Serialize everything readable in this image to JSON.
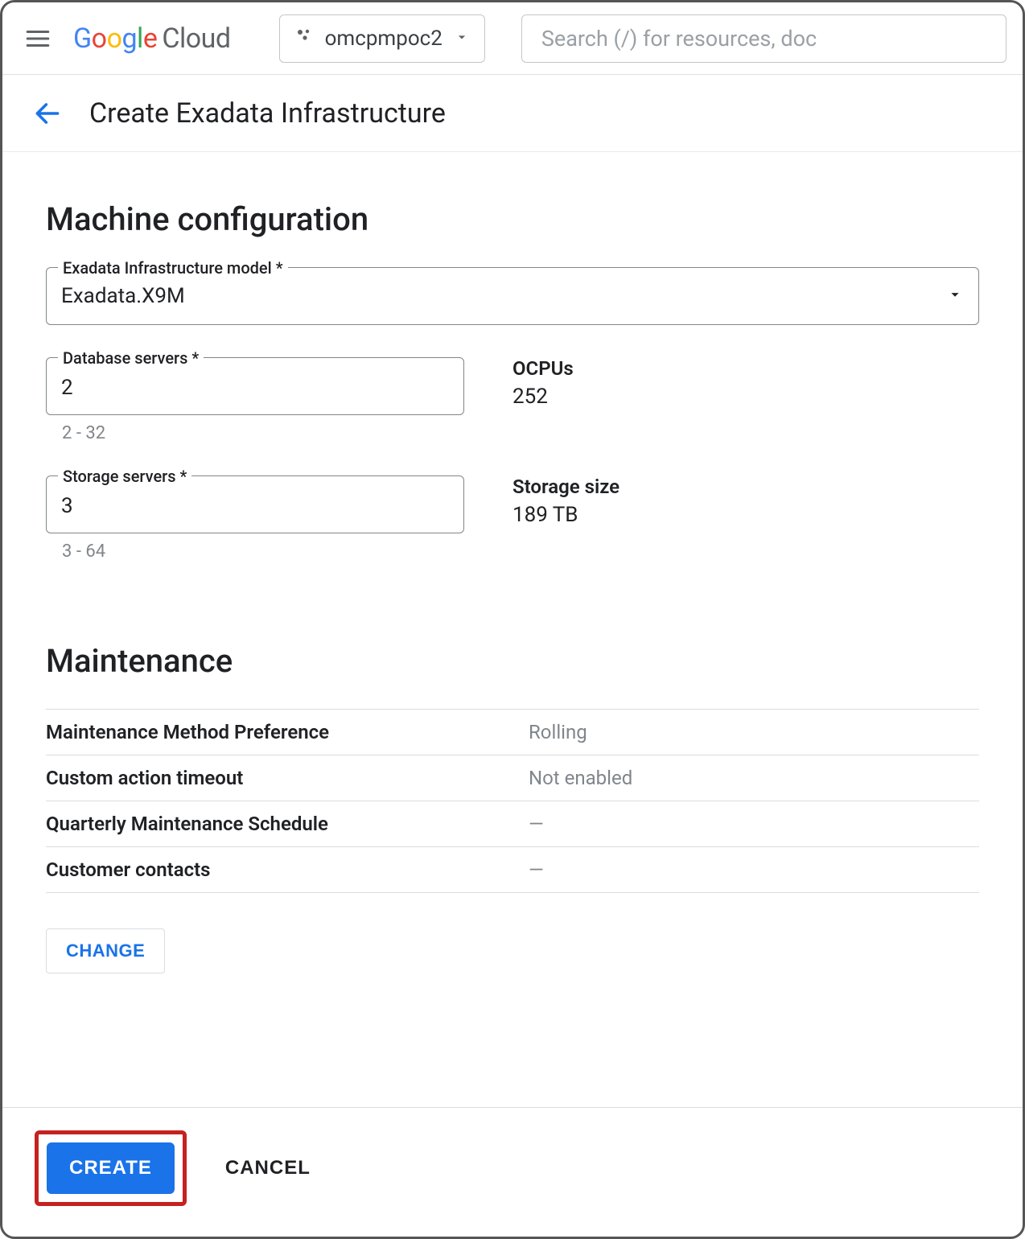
{
  "header": {
    "logo_google": [
      "G",
      "o",
      "o",
      "g",
      "l",
      "e"
    ],
    "logo_cloud": "Cloud",
    "project_name": "omcpmpoc2",
    "search_placeholder": "Search (/) for resources, doc"
  },
  "subheader": {
    "title": "Create Exadata Infrastructure"
  },
  "machine_config": {
    "section_title": "Machine configuration",
    "model_label": "Exadata Infrastructure model *",
    "model_value": "Exadata.X9M",
    "db_servers_label": "Database servers *",
    "db_servers_value": "2",
    "db_servers_helper": "2 - 32",
    "ocpus_label": "OCPUs",
    "ocpus_value": "252",
    "storage_servers_label": "Storage servers *",
    "storage_servers_value": "3",
    "storage_servers_helper": "3 - 64",
    "storage_size_label": "Storage size",
    "storage_size_value": "189 TB"
  },
  "maintenance": {
    "section_title": "Maintenance",
    "rows": [
      {
        "label": "Maintenance Method Preference",
        "value": "Rolling"
      },
      {
        "label": "Custom action timeout",
        "value": "Not enabled"
      },
      {
        "label": "Quarterly Maintenance Schedule",
        "value": "—"
      },
      {
        "label": "Customer contacts",
        "value": "—"
      }
    ],
    "change_label": "CHANGE"
  },
  "footer": {
    "create_label": "CREATE",
    "cancel_label": "CANCEL"
  }
}
